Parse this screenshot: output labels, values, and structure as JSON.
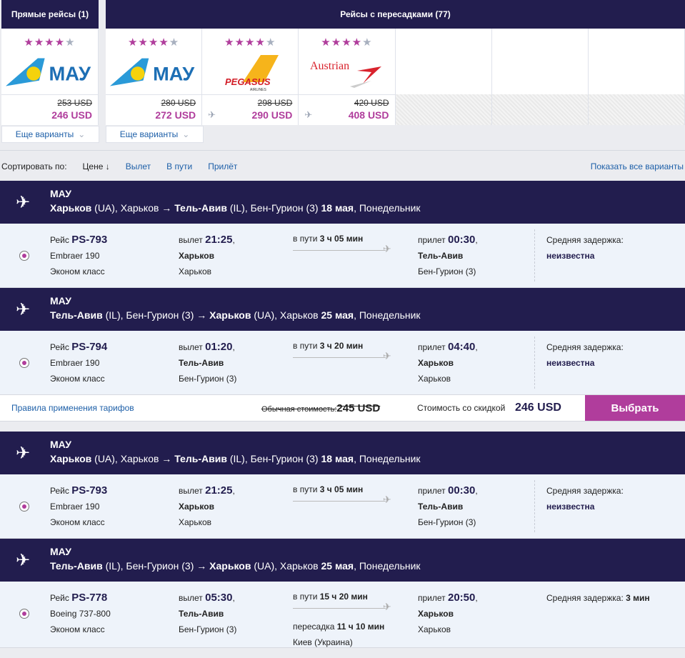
{
  "tabs": {
    "direct": {
      "title": "Прямые рейсы (1)",
      "cards": [
        {
          "airline": "МАУ",
          "stars": 4,
          "old_price": "253 USD",
          "price": "246 USD",
          "transfer": false
        }
      ],
      "more": "Еще варианты"
    },
    "transfer": {
      "title": "Рейсы с пересадками (77)",
      "cards": [
        {
          "airline": "МАУ",
          "stars": 4,
          "old_price": "280 USD",
          "price": "272 USD",
          "transfer": false
        },
        {
          "airline": "PEGASUS",
          "stars": 4,
          "old_price": "298 USD",
          "price": "290 USD",
          "transfer": true
        },
        {
          "airline": "Austrian",
          "stars": 4,
          "old_price": "420 USD",
          "price": "408 USD",
          "transfer": true
        }
      ],
      "more": "Еще варианты"
    }
  },
  "sort": {
    "label": "Сортировать по:",
    "options": [
      "Цене ↓",
      "Вылет",
      "В пути",
      "Прилёт"
    ],
    "show_all": "Показать все варианты"
  },
  "offers": [
    {
      "segments": [
        {
          "airline": "МАУ",
          "from": "Харьков",
          "from_cc": " (UA), Харьков → ",
          "to": "Тель-Авив",
          "to_cc": " (IL), Бен-Гурион (3) ",
          "date": "18 мая",
          "dow": ", Понедельник",
          "flight": "PS-793",
          "aircraft": "Embraer 190",
          "class": "Эконом класс",
          "dep": "21:25",
          "dep_city": "Харьков",
          "dep_airport": "Харьков",
          "duration": "3 ч 05 мин",
          "arr": "00:30",
          "arr_city": "Тель-Авив",
          "arr_airport": "Бен-Гурион (3)",
          "delay_label": "Средняя задержка:",
          "delay": "неизвестна"
        },
        {
          "airline": "МАУ",
          "from": "Тель-Авив",
          "from_cc": " (IL), Бен-Гурион (3) → ",
          "to": "Харьков",
          "to_cc": " (UA), Харьков ",
          "date": "25 мая",
          "dow": ", Понедельник",
          "flight": "PS-794",
          "aircraft": "Embraer 190",
          "class": "Эконом класс",
          "dep": "01:20",
          "dep_city": "Тель-Авив",
          "dep_airport": "Бен-Гурион (3)",
          "duration": "3 ч 20 мин",
          "arr": "04:40",
          "arr_city": "Харьков",
          "arr_airport": "Харьков",
          "delay_label": "Средняя задержка:",
          "delay": "неизвестна"
        }
      ],
      "footer": {
        "rules": "Правила применения тарифов",
        "usual_label": "Обычная стоимость:",
        "usual_price": "245 USD",
        "discount_label": "Стоимость со скидкой",
        "price": "246 USD",
        "select": "Выбрать"
      }
    },
    {
      "segments": [
        {
          "airline": "МАУ",
          "from": "Харьков",
          "from_cc": " (UA), Харьков → ",
          "to": "Тель-Авив",
          "to_cc": " (IL), Бен-Гурион (3) ",
          "date": "18 мая",
          "dow": ", Понедельник",
          "flight": "PS-793",
          "aircraft": "Embraer 190",
          "class": "Эконом класс",
          "dep": "21:25",
          "dep_city": "Харьков",
          "dep_airport": "Харьков",
          "duration": "3 ч 05 мин",
          "arr": "00:30",
          "arr_city": "Тель-Авив",
          "arr_airport": "Бен-Гурион (3)",
          "delay_label": "Средняя задержка:",
          "delay": "неизвестна"
        },
        {
          "airline": "МАУ",
          "from": "Тель-Авив",
          "from_cc": " (IL), Бен-Гурион (3) → ",
          "to": "Харьков",
          "to_cc": " (UA), Харьков ",
          "date": "25 мая",
          "dow": ", Понедельник",
          "flight": "PS-778",
          "aircraft": "Boeing 737-800",
          "class": "Эконом класс",
          "dep": "05:30",
          "dep_city": "Тель-Авив",
          "dep_airport": "Бен-Гурион (3)",
          "duration": "15 ч 20 мин",
          "arr": "20:50",
          "arr_city": "Харьков",
          "arr_airport": "Харьков",
          "delay_label": "Средняя задержка:",
          "delay": "3 мин",
          "transfer": "11 ч 10 мин",
          "transfer_city": "Киев (Украина)"
        }
      ]
    }
  ],
  "labels": {
    "flight": "Рейс ",
    "dep": "вылет ",
    "arr": "прилет ",
    "dur": "в пути ",
    "transfer": "пересадка "
  },
  "colors": {
    "navy": "#221d4e",
    "accent": "#b03d9c",
    "link": "#1d5fa8"
  }
}
